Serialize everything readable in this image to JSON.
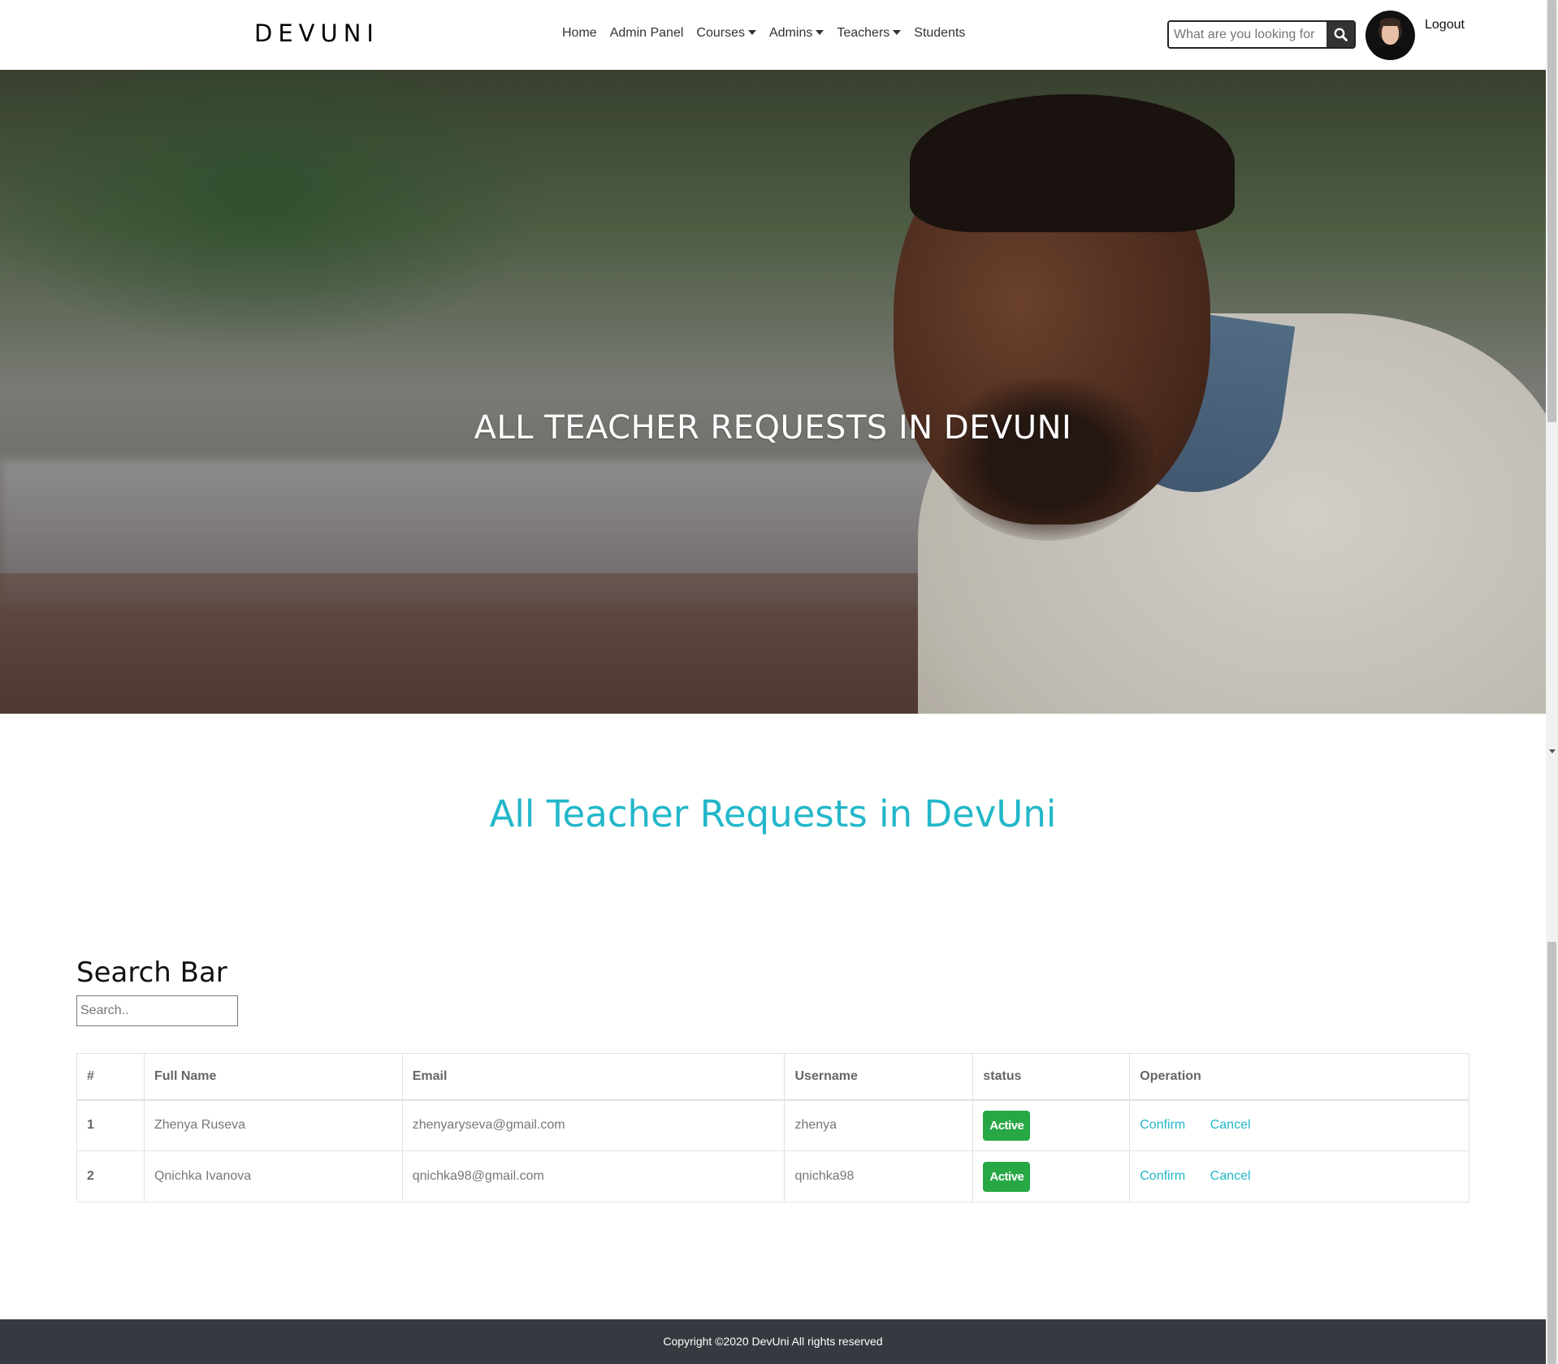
{
  "navbar": {
    "brand": "DEVUNI",
    "links": [
      {
        "label": "Home",
        "dropdown": false
      },
      {
        "label": "Admin Panel",
        "dropdown": false
      },
      {
        "label": "Courses",
        "dropdown": true
      },
      {
        "label": "Admins",
        "dropdown": true
      },
      {
        "label": "Teachers",
        "dropdown": true
      },
      {
        "label": "Students",
        "dropdown": false
      }
    ],
    "search_placeholder": "What are you looking for",
    "search_icon": "search-icon",
    "logout_label": "Logout"
  },
  "hero": {
    "title": "ALL TEACHER REQUESTS IN DEVUNI"
  },
  "section": {
    "title": "All Teacher Requests in DevUni",
    "title_color": "#22b7c9"
  },
  "search_bar": {
    "label": "Search Bar",
    "placeholder": "Search.."
  },
  "table": {
    "headers": [
      "#",
      "Full Name",
      "Email",
      "Username",
      "status",
      "Operation"
    ],
    "rows": [
      {
        "num": "1",
        "full_name": "Zhenya Ruseva",
        "email": "zhenyaryseva@gmail.com",
        "username": "zhenya",
        "status": "Active",
        "confirm": "Confirm",
        "cancel": "Cancel"
      },
      {
        "num": "2",
        "full_name": "Qnichka Ivanova",
        "email": "qnichka98@gmail.com",
        "username": "qnichka98",
        "status": "Active",
        "confirm": "Confirm",
        "cancel": "Cancel"
      }
    ],
    "status_color": "#28a745",
    "link_color": "#22b7c9"
  },
  "footer": {
    "text": "Copyright ©2020 DevUni All rights reserved",
    "background": "#343a40"
  }
}
